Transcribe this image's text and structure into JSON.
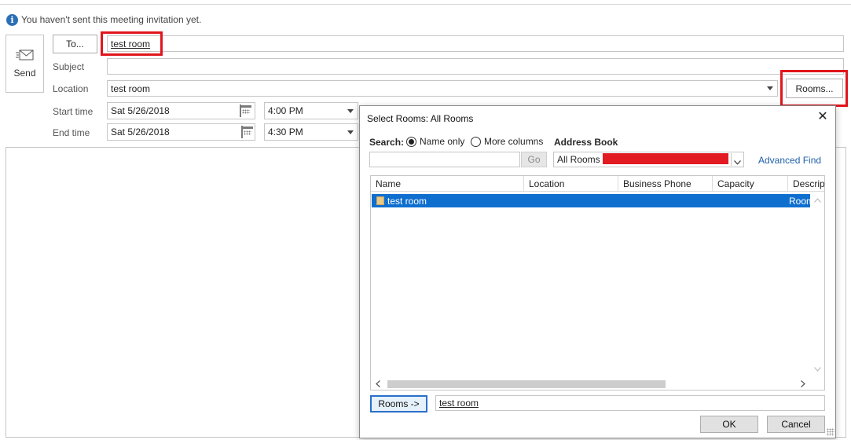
{
  "info_bar": {
    "message": "You haven't sent this meeting invitation yet."
  },
  "send": {
    "label": "Send"
  },
  "to": {
    "button_label": "To...",
    "value": "test room"
  },
  "subject": {
    "label": "Subject",
    "value": ""
  },
  "location": {
    "label": "Location",
    "value": "test room",
    "rooms_button": "Rooms..."
  },
  "start": {
    "label": "Start time",
    "date": "Sat 5/26/2018",
    "time": "4:00 PM"
  },
  "end": {
    "label": "End time",
    "date": "Sat 5/26/2018",
    "time": "4:30 PM"
  },
  "dialog": {
    "title": "Select Rooms: All Rooms",
    "search_label": "Search:",
    "option_name_only": "Name only",
    "option_more_columns": "More columns",
    "address_book_label": "Address Book",
    "search_value": "",
    "go_button": "Go",
    "address_book_value": "All Rooms -",
    "advanced_find": "Advanced Find",
    "columns": [
      "Name",
      "Location",
      "Business Phone",
      "Capacity",
      "Descrip"
    ],
    "rows": [
      {
        "name": "test room",
        "location": "",
        "phone": "",
        "capacity": "",
        "description": "Room"
      }
    ],
    "rooms_button": "Rooms ->",
    "rooms_value": "test room",
    "ok_button": "OK",
    "cancel_button": "Cancel"
  },
  "colors": {
    "highlight_red": "#e1151c",
    "selection_blue": "#0f6fcf",
    "link_blue": "#1f5fa8"
  }
}
